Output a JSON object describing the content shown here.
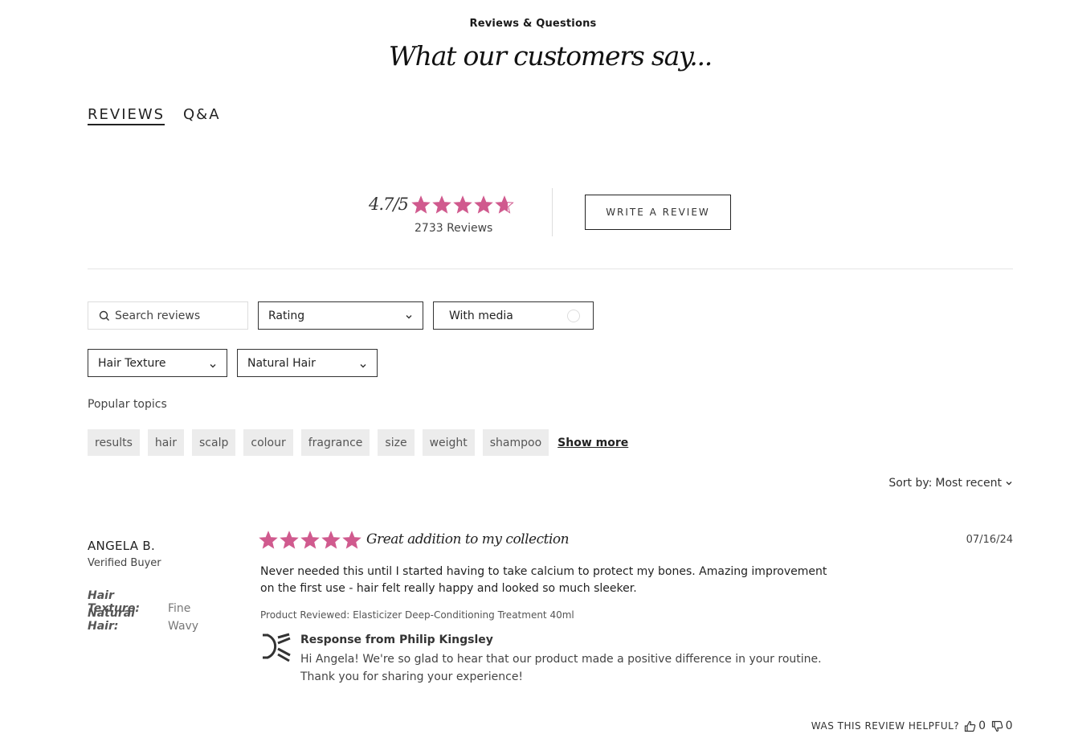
{
  "header": {
    "eyebrow": "Reviews & Questions",
    "title": "What our customers say..."
  },
  "tabs": [
    {
      "label": "REVIEWS",
      "active": true
    },
    {
      "label": "Q&A",
      "active": false
    }
  ],
  "summary": {
    "average": "4.7/5",
    "rating_value": 4.7,
    "rating_max": 5,
    "count_label": "2733 Reviews",
    "write_review_label": "WRITE A REVIEW",
    "star_color": "#d05a8e"
  },
  "filters": {
    "search_placeholder": "Search reviews",
    "rating_label": "Rating",
    "media_label": "With media",
    "hair_texture_label": "Hair Texture",
    "natural_hair_label": "Natural Hair"
  },
  "popular_topics": {
    "label": "Popular topics",
    "chips": [
      "results",
      "hair",
      "scalp",
      "colour",
      "fragrance",
      "size",
      "weight",
      "shampoo"
    ],
    "show_more": "Show more"
  },
  "sort": {
    "label": "Sort by:",
    "value": "Most recent"
  },
  "review": {
    "name": "ANGELA B.",
    "verified": "Verified Buyer",
    "attributes": [
      {
        "key": "Hair Texture:",
        "value": "Fine"
      },
      {
        "key": "Natural Hair:",
        "value": "Wavy"
      }
    ],
    "rating": 5,
    "title": "Great addition to my collection",
    "date": "07/16/24",
    "body": "Never needed this until I started having to take calcium to protect my bones. Amazing improvement on the first use - hair felt really happy and looked so much sleeker.",
    "product_label": "Product Reviewed:",
    "product_name": "Elasticizer Deep-Conditioning Treatment 40ml",
    "response_title": "Response from Philip Kingsley",
    "response_body": "Hi Angela! We're so glad to hear that our product made a positive difference in your routine. Thank you for sharing your experience!",
    "helpful_label": "WAS THIS REVIEW HELPFUL?",
    "upvotes": "0",
    "downvotes": "0"
  }
}
